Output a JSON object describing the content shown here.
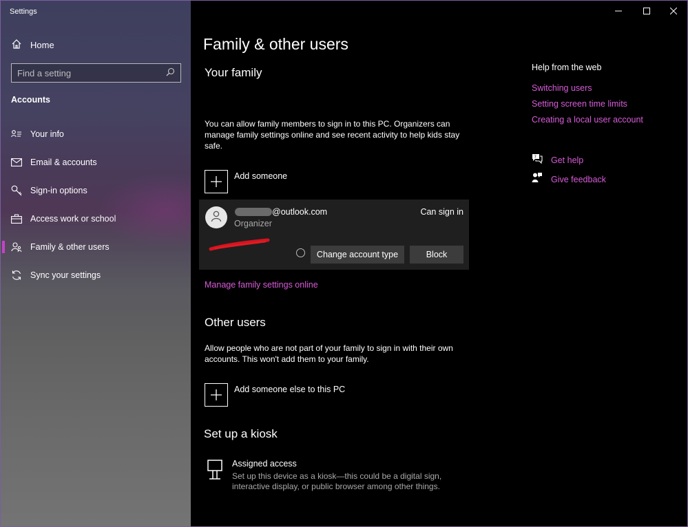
{
  "window": {
    "title": "Settings"
  },
  "controls": {
    "minimize": "–",
    "maximize": "☐",
    "close": "✕"
  },
  "sidebar": {
    "home_label": "Home",
    "search": {
      "placeholder": "Find a setting",
      "icon": "search-icon"
    },
    "section_title": "Accounts",
    "items": [
      {
        "label": "Your info",
        "icon": "contact-card-icon"
      },
      {
        "label": "Email & accounts",
        "icon": "envelope-icon"
      },
      {
        "label": "Sign-in options",
        "icon": "key-icon"
      },
      {
        "label": "Access work or school",
        "icon": "briefcase-icon"
      },
      {
        "label": "Family & other users",
        "icon": "people-icon"
      },
      {
        "label": "Sync your settings",
        "icon": "sync-icon"
      }
    ],
    "active_item": "Family & other users",
    "accent_color": "#c543c5"
  },
  "main": {
    "page_title": "Family & other users",
    "family": {
      "heading": "Your family",
      "description": "You can allow family members to sign in to this PC. Organizers can manage family settings online and see recent activity to help kids stay safe.",
      "add_label": "Add someone",
      "account": {
        "email_suffix": "@outlook.com",
        "role": "Organizer",
        "status": "Can sign in",
        "change_type_label": "Change account type",
        "block_label": "Block"
      },
      "manage_link": "Manage family settings online"
    },
    "other_users": {
      "heading": "Other users",
      "description": "Allow people who are not part of your family to sign in with their own accounts. This won't add them to your family.",
      "add_label": "Add someone else to this PC"
    },
    "kiosk": {
      "heading": "Set up a kiosk",
      "item_title": "Assigned access",
      "item_desc_line1": "Set up this device as a kiosk—this could be a digital sign,",
      "item_desc_line2": "interactive display, or public browser among other things."
    }
  },
  "help": {
    "title": "Help from the web",
    "links": [
      "Switching users",
      "Setting screen time limits",
      "Creating a local user account"
    ],
    "get_help": "Get help",
    "give_feedback": "Give feedback",
    "link_color": "#d75bd7"
  }
}
